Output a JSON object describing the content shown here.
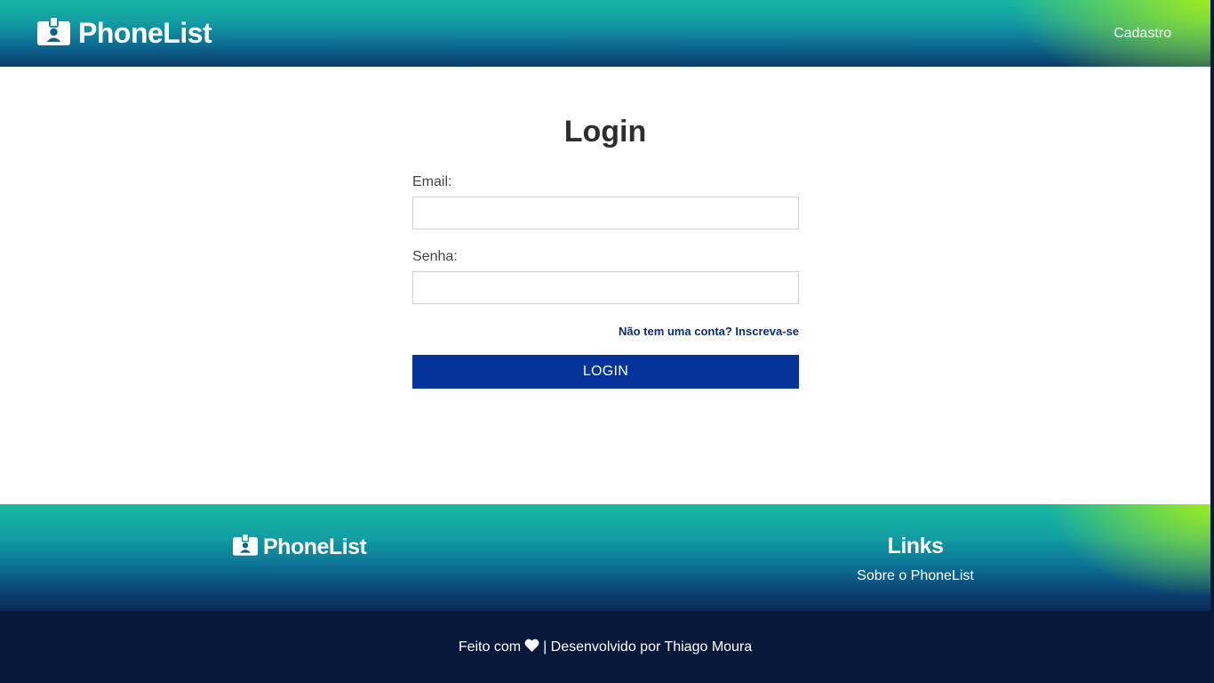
{
  "header": {
    "brand": "PhoneList",
    "brand_icon": "id-badge-icon",
    "nav_link": "Cadastro"
  },
  "login": {
    "title": "Login",
    "email_label": "Email:",
    "email_value": "",
    "password_label": "Senha:",
    "password_value": "",
    "signup_link": "Não tem uma conta? Inscreva-se",
    "submit_label": "LOGIN"
  },
  "footer": {
    "brand": "PhoneList",
    "links_title": "Links",
    "links": [
      "Sobre o PhoneList"
    ],
    "credit_prefix": "Feito com",
    "credit_icon": "heart-icon",
    "credit_suffix": "| Desenvolvido por Thiago Moura"
  },
  "colors": {
    "primary_button": "#04339a",
    "gradient_green": "#a4ee18",
    "gradient_teal": "#12a0a4",
    "gradient_navy": "#0b3a6a",
    "bottom_bar": "#07183a",
    "link": "#0b2c6e"
  }
}
